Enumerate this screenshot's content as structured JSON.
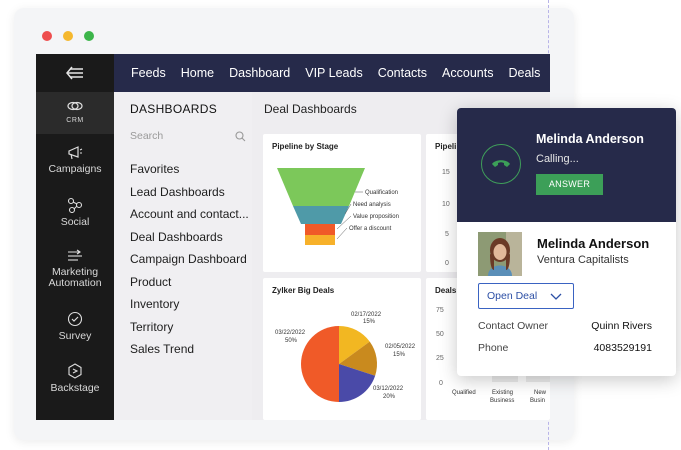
{
  "window": {
    "dot_colors": [
      "#ee4e4e",
      "#f5b82e",
      "#3cb54a"
    ]
  },
  "leftnav": {
    "items": [
      {
        "label": "CRM",
        "icon": "crm-icon"
      },
      {
        "label": "Campaigns",
        "icon": "campaigns-icon"
      },
      {
        "label": "Social",
        "icon": "social-icon"
      },
      {
        "label": "Marketing Automation",
        "icon": "marketing-automation-icon"
      },
      {
        "label": "Survey",
        "icon": "survey-icon"
      },
      {
        "label": "Backstage",
        "icon": "backstage-icon"
      }
    ],
    "marketing_line1": "Marketing",
    "marketing_line2": "Automation"
  },
  "topbar": {
    "tabs": [
      "Feeds",
      "Home",
      "Dashboard",
      "VIP Leads",
      "Contacts",
      "Accounts",
      "Deals"
    ]
  },
  "sidepanel": {
    "title": "DASHBOARDS",
    "search_placeholder": "Search",
    "items": [
      "Favorites",
      "Lead Dashboards",
      "Account and contact...",
      "Deal Dashboards",
      "Campaign Dashboard",
      "Product",
      "Inventory",
      "Territory",
      "Sales Trend"
    ]
  },
  "main": {
    "title": "Deal Dashboards",
    "pipeline_title": "Pipeline by Stage",
    "pipeline2_title": "Pipeli",
    "bigdeals_title": "Zylker Big Deals",
    "deals_title": "Deals"
  },
  "chart_data": [
    {
      "type": "funnel",
      "title": "Pipeline by Stage",
      "categories": [
        "Qualification",
        "Need analysis",
        "Value proposition",
        "Offer a discount"
      ],
      "colors": [
        "#7cc85a",
        "#4f9aa8",
        "#f05a28",
        "#f7b12a"
      ]
    },
    {
      "type": "bar",
      "title": "Pipeli",
      "y_ticks": [
        "15",
        "10",
        "5",
        "0"
      ]
    },
    {
      "type": "pie",
      "title": "Zylker Big Deals",
      "slices": [
        {
          "label": "02/17/2022",
          "value": 15,
          "text": "15%",
          "color": "#f2b722"
        },
        {
          "label": "02/05/2022",
          "value": 15,
          "text": "15%",
          "color": "#c98a1e"
        },
        {
          "label": "03/12/2022",
          "value": 20,
          "text": "20%",
          "color": "#4a4aa8"
        },
        {
          "label": "03/22/2022",
          "value": 50,
          "text": "50%",
          "color": "#f05a28"
        }
      ]
    },
    {
      "type": "bar",
      "title": "Deals",
      "y_ticks": [
        "75",
        "50",
        "25",
        "0"
      ],
      "categories": [
        "Qualified",
        "Existing Business",
        "New Busin"
      ],
      "category_lines": [
        [
          "Qualified"
        ],
        [
          "Existing",
          "Business"
        ],
        [
          "New",
          "Busin"
        ]
      ]
    }
  ],
  "popup": {
    "caller_name": "Melinda Anderson",
    "status": "Calling...",
    "answer_label": "ANSWER",
    "contact_name": "Melinda Anderson",
    "company": "Ventura Capitalists",
    "open_deal_label": "Open Deal",
    "fields": [
      {
        "label": "Contact Owner",
        "value": "Quinn Rivers"
      },
      {
        "label": "Phone",
        "value": "4083529191"
      }
    ],
    "accent_green": "#3c9f58",
    "header_color": "#262a4a"
  }
}
